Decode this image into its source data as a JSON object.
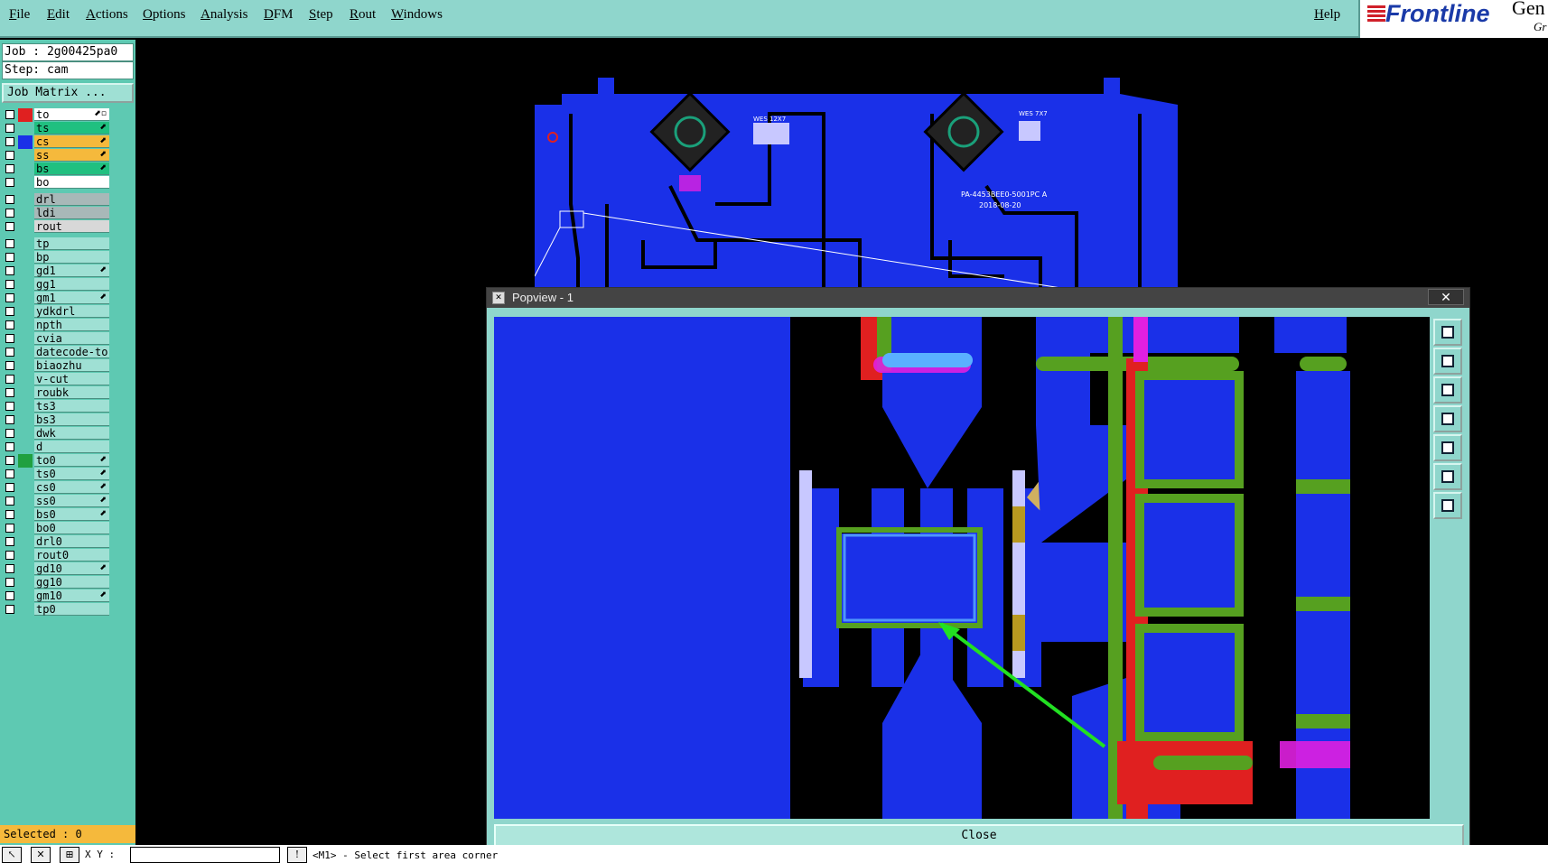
{
  "menu": [
    "File",
    "Edit",
    "Actions",
    "Options",
    "Analysis",
    "DFM",
    "Step",
    "Rout",
    "Windows"
  ],
  "help": "Help",
  "logo": {
    "name": "Frontline",
    "gen": "Gen",
    "gr": "Gr"
  },
  "job": "Job : 2g00425pa0",
  "step": "Step: cam",
  "job_matrix": "Job Matrix ...",
  "layers": [
    {
      "name": "to",
      "color": "#ffffff",
      "swatch": "#e02020",
      "mark": "⬈▫"
    },
    {
      "name": "ts",
      "color": "#20c080",
      "swatch": "",
      "mark": "⬈"
    },
    {
      "name": "cs",
      "color": "#f5b93c",
      "swatch": "#1a30e8",
      "mark": "⬈"
    },
    {
      "name": "ss",
      "color": "#f5b93c",
      "swatch": "",
      "mark": "⬈"
    },
    {
      "name": "bs",
      "color": "#20c080",
      "swatch": "",
      "mark": "⬈"
    },
    {
      "name": "bo",
      "color": "#ffffff",
      "swatch": "",
      "mark": ""
    },
    {
      "name": "drl",
      "color": "#a8b8b8",
      "swatch": "",
      "mark": ""
    },
    {
      "name": "ldi",
      "color": "#a8b8b8",
      "swatch": "",
      "mark": ""
    },
    {
      "name": "rout",
      "color": "#d8d8d8",
      "swatch": "",
      "mark": ""
    },
    {
      "name": "tp",
      "color": "#9fe0d4",
      "swatch": "",
      "mark": ""
    },
    {
      "name": "bp",
      "color": "#9fe0d4",
      "swatch": "",
      "mark": ""
    },
    {
      "name": "gd1",
      "color": "#9fe0d4",
      "swatch": "",
      "mark": "⬈"
    },
    {
      "name": "gg1",
      "color": "#9fe0d4",
      "swatch": "",
      "mark": ""
    },
    {
      "name": "gm1",
      "color": "#9fe0d4",
      "swatch": "",
      "mark": "⬈"
    },
    {
      "name": "ydkdrl",
      "color": "#9fe0d4",
      "swatch": "",
      "mark": ""
    },
    {
      "name": "npth",
      "color": "#9fe0d4",
      "swatch": "",
      "mark": ""
    },
    {
      "name": "cvia",
      "color": "#9fe0d4",
      "swatch": "",
      "mark": ""
    },
    {
      "name": "datecode-to",
      "color": "#9fe0d4",
      "swatch": "",
      "mark": ""
    },
    {
      "name": "biaozhu",
      "color": "#9fe0d4",
      "swatch": "",
      "mark": ""
    },
    {
      "name": "v-cut",
      "color": "#9fe0d4",
      "swatch": "",
      "mark": ""
    },
    {
      "name": "roubk",
      "color": "#9fe0d4",
      "swatch": "",
      "mark": ""
    },
    {
      "name": "ts3",
      "color": "#9fe0d4",
      "swatch": "",
      "mark": ""
    },
    {
      "name": "bs3",
      "color": "#9fe0d4",
      "swatch": "",
      "mark": ""
    },
    {
      "name": "dwk",
      "color": "#9fe0d4",
      "swatch": "",
      "mark": ""
    },
    {
      "name": "d",
      "color": "#9fe0d4",
      "swatch": "",
      "mark": ""
    },
    {
      "name": "to0",
      "color": "#9fe0d4",
      "swatch": "#20a040",
      "mark": "⬈"
    },
    {
      "name": "ts0",
      "color": "#9fe0d4",
      "swatch": "",
      "mark": "⬈"
    },
    {
      "name": "cs0",
      "color": "#9fe0d4",
      "swatch": "",
      "mark": "⬈"
    },
    {
      "name": "ss0",
      "color": "#9fe0d4",
      "swatch": "",
      "mark": "⬈"
    },
    {
      "name": "bs0",
      "color": "#9fe0d4",
      "swatch": "",
      "mark": "⬈"
    },
    {
      "name": "bo0",
      "color": "#9fe0d4",
      "swatch": "",
      "mark": ""
    },
    {
      "name": "drl0",
      "color": "#9fe0d4",
      "swatch": "",
      "mark": ""
    },
    {
      "name": "rout0",
      "color": "#9fe0d4",
      "swatch": "",
      "mark": ""
    },
    {
      "name": "gd10",
      "color": "#9fe0d4",
      "swatch": "",
      "mark": "⬈"
    },
    {
      "name": "gg10",
      "color": "#9fe0d4",
      "swatch": "",
      "mark": ""
    },
    {
      "name": "gm10",
      "color": "#9fe0d4",
      "swatch": "",
      "mark": "⬈"
    },
    {
      "name": "tp0",
      "color": "#9fe0d4",
      "swatch": "",
      "mark": ""
    }
  ],
  "selected": "Selected : 0",
  "status": {
    "xy_label": "X Y :",
    "message": "<M1> - Select first area corner"
  },
  "board": {
    "label_left": "WES 12X7",
    "label_right": "WES 7X7",
    "part": "PA-4453BEE0-5001PC A",
    "date": "2018-08-20"
  },
  "popview": {
    "title": "Popview - 1",
    "close": "Close",
    "close_x": "✕"
  }
}
